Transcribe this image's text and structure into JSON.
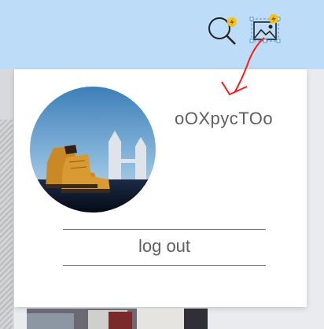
{
  "toolbar": {
    "search_icon": "magnifier-icon",
    "image_icon": "image-icon",
    "badge_color": "#f5c21a"
  },
  "menu": {
    "username": "oOXpycTOo",
    "logout_label": "log out"
  },
  "colors": {
    "topbar": "#bcdcf7",
    "annotation": "#ff0000"
  }
}
